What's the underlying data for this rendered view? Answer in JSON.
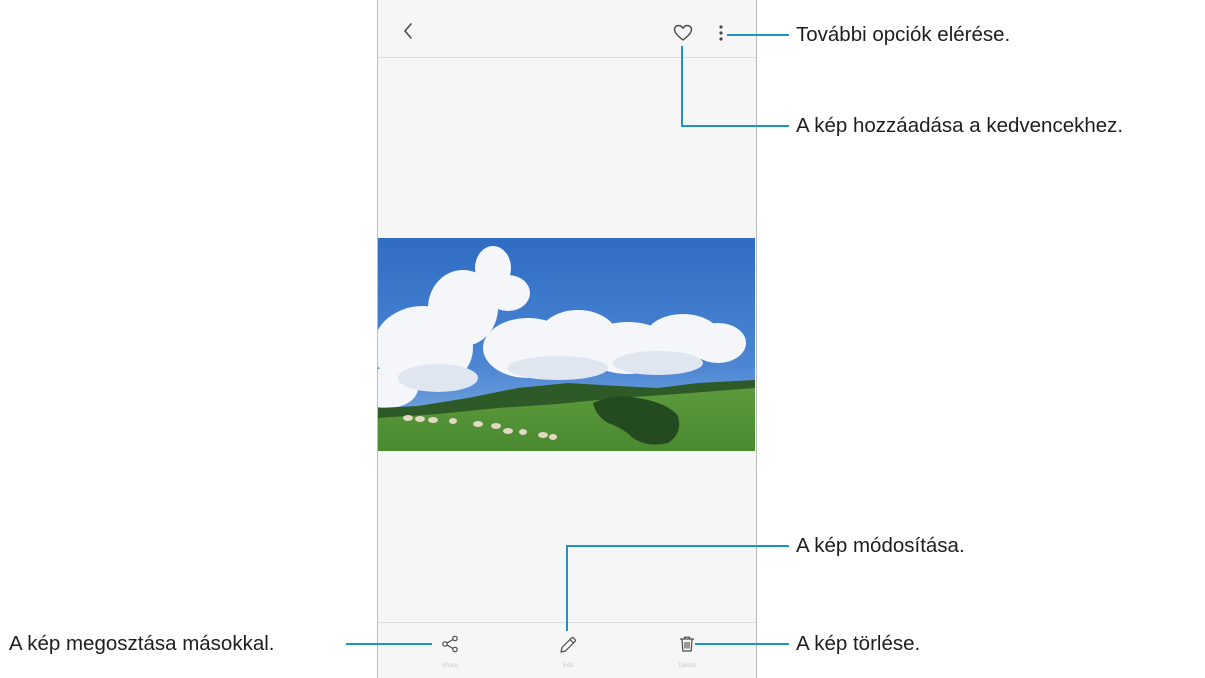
{
  "callouts": {
    "more_options": "További opciók elérése.",
    "add_favorite": "A kép hozzáadása a kedvencekhez.",
    "edit": "A kép módosítása.",
    "share": "A kép megosztása másokkal.",
    "delete": "A kép törlése."
  },
  "toolbar": {
    "share_label": "Share",
    "edit_label": "Edit",
    "delete_label": "Delete"
  },
  "icons": {
    "back": "chevron-left-icon",
    "favorite": "heart-icon",
    "more": "more-vertical-icon",
    "share": "share-icon",
    "edit": "pencil-icon",
    "delete": "trash-icon"
  },
  "colors": {
    "callout_line": "#1c93c9",
    "screen_background": "#f6f6f6"
  }
}
